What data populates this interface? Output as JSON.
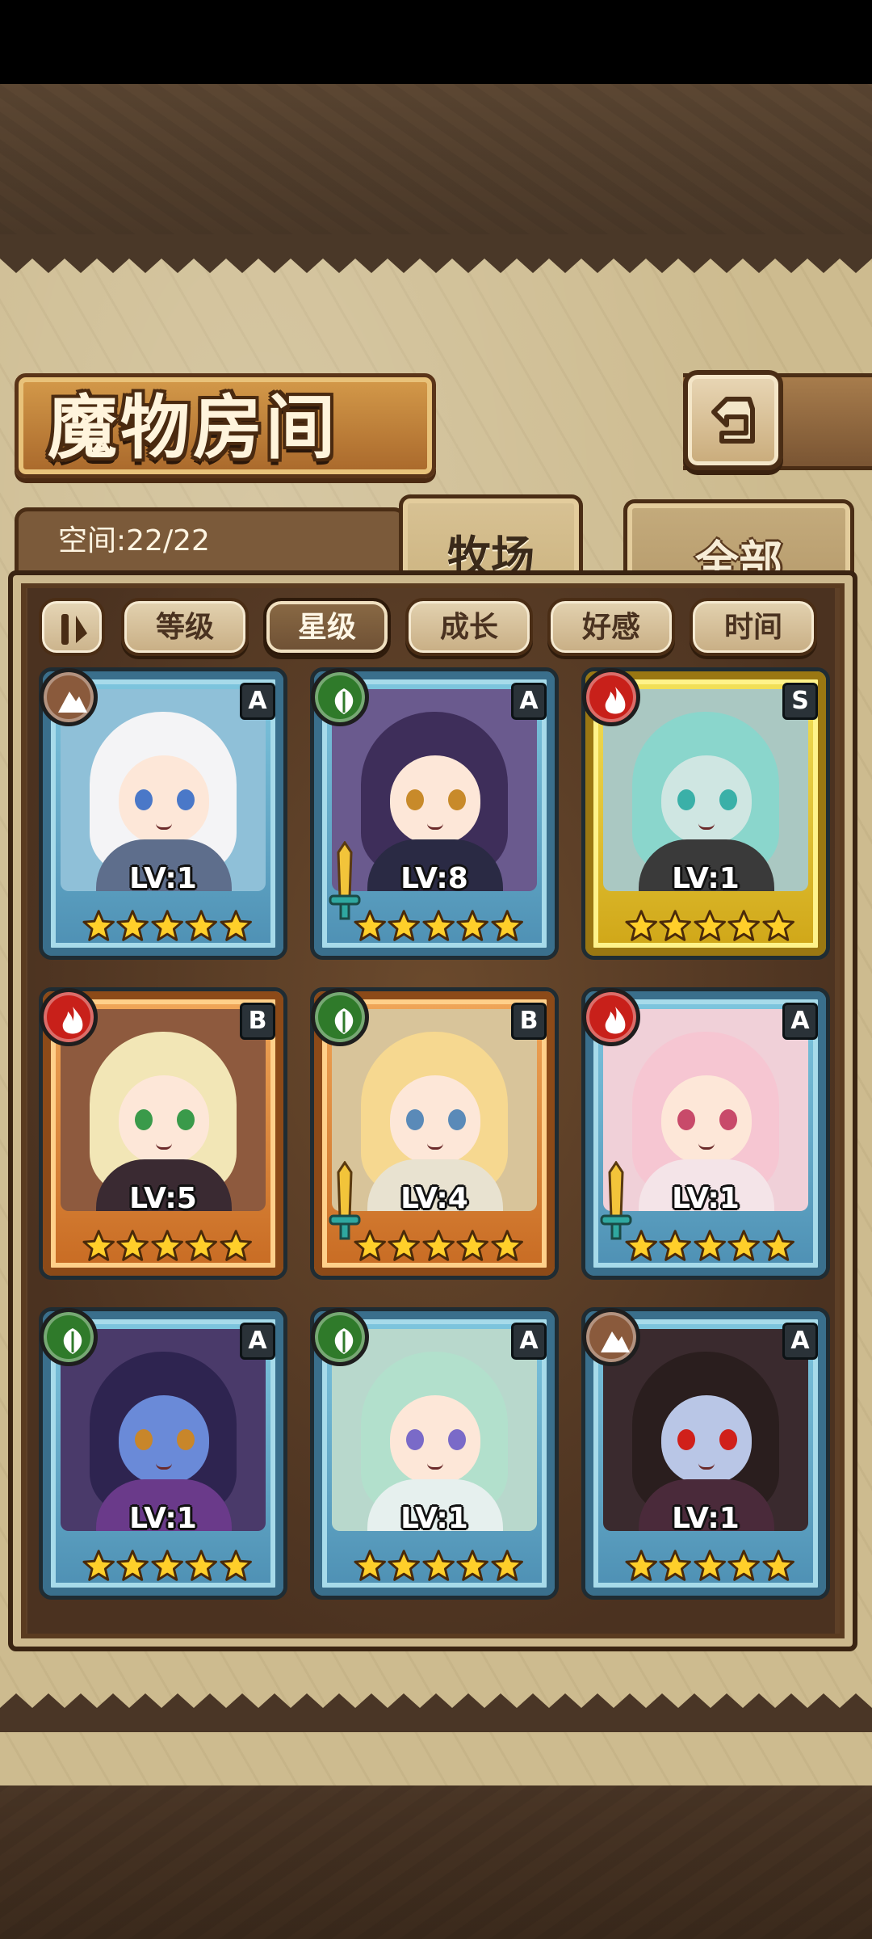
{
  "header": {
    "title": "魔物房间",
    "back_icon": "back-arrow-icon"
  },
  "tabs": {
    "capacity": "空间:22/22",
    "items": [
      {
        "label": "牧场",
        "active": true
      },
      {
        "label": "全部",
        "active": false
      }
    ]
  },
  "sort": {
    "toggle_icon": "sort-order-icon",
    "buttons": [
      {
        "label": "等级",
        "active": false
      },
      {
        "label": "星级",
        "active": true
      },
      {
        "label": "成长",
        "active": false
      },
      {
        "label": "好感",
        "active": false
      },
      {
        "label": "时间",
        "active": false
      }
    ]
  },
  "colors": {
    "element_earth": "#8a5a3c",
    "element_nature": "#2f7a2a",
    "element_fire": "#c8201a",
    "rank_A": "#4d8fb3",
    "rank_S": "#cfa516",
    "rank_B": "#c76a22"
  },
  "monsters": [
    {
      "element": "earth",
      "rank": "A",
      "level": "LV:1",
      "stars": 5,
      "weapon": false
    },
    {
      "element": "nature",
      "rank": "A",
      "level": "LV:8",
      "stars": 5,
      "weapon": true
    },
    {
      "element": "fire",
      "rank": "S",
      "level": "LV:1",
      "stars": 5,
      "weapon": false
    },
    {
      "element": "fire",
      "rank": "B",
      "level": "LV:5",
      "stars": 5,
      "weapon": false
    },
    {
      "element": "nature",
      "rank": "B",
      "level": "LV:4",
      "stars": 5,
      "weapon": true
    },
    {
      "element": "fire",
      "rank": "A",
      "level": "LV:1",
      "stars": 5,
      "weapon": true
    },
    {
      "element": "nature",
      "rank": "A",
      "level": "LV:1",
      "stars": 5,
      "weapon": false
    },
    {
      "element": "nature",
      "rank": "A",
      "level": "LV:1",
      "stars": 5,
      "weapon": false
    },
    {
      "element": "earth",
      "rank": "A",
      "level": "LV:1",
      "stars": 5,
      "weapon": false
    }
  ]
}
